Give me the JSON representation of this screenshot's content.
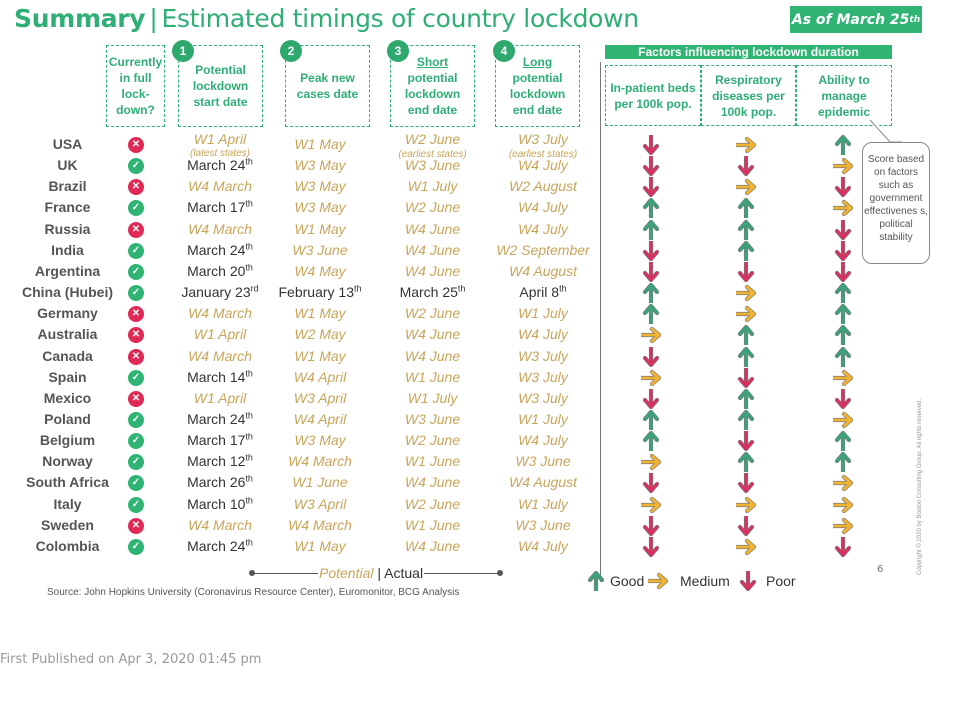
{
  "header": {
    "title_bold": "Summary",
    "title_sep": "|",
    "title_rest": "Estimated timings of country lockdown",
    "as_of_prefix": "As of March 25",
    "as_of_suffix": "th"
  },
  "columns": {
    "currently": "Currently in full lock-down?",
    "c1_num": "1",
    "c1_label": "Potential lockdown start date",
    "c2_num": "2",
    "c2_label": "Peak new cases date",
    "c3_num": "3",
    "c3_label_u": "Short",
    "c3_label": "potential lockdown end date",
    "c4_num": "4",
    "c4_label_u": "Long",
    "c4_label": "potential lockdown end date"
  },
  "factors": {
    "title": "Factors influencing lockdown duration",
    "f1": "In-patient beds per 100k pop.",
    "f2": "Respiratory diseases per 100k pop.",
    "f3": "Ability to manage epidemic",
    "callout": "Score based on factors such as government effectivenes s, political stability"
  },
  "notes": {
    "usa_start": "(latest states)",
    "usa_short": "(earliest states)",
    "usa_long": "(earliest states)"
  },
  "rows": [
    {
      "country": "USA",
      "locked": false,
      "start": "W1 April",
      "start_sup": "",
      "start_actual": false,
      "peak": "W1 May",
      "peak_sup": "",
      "peak_actual": false,
      "short": "W2 June",
      "short_sup": "",
      "short_actual": false,
      "long": "W3 July",
      "long_sup": "",
      "long_actual": false,
      "beds": "down",
      "resp": "right",
      "ability": "up"
    },
    {
      "country": "UK",
      "locked": true,
      "start": "March 24",
      "start_sup": "th",
      "start_actual": true,
      "peak": "W3 May",
      "peak_sup": "",
      "peak_actual": false,
      "short": "W3 June",
      "short_sup": "",
      "short_actual": false,
      "long": "W4 July",
      "long_sup": "",
      "long_actual": false,
      "beds": "down",
      "resp": "down",
      "ability": "right"
    },
    {
      "country": "Brazil",
      "locked": false,
      "start": "W4 March",
      "start_sup": "",
      "start_actual": false,
      "peak": "W3 May",
      "peak_sup": "",
      "peak_actual": false,
      "short": "W1 July",
      "short_sup": "",
      "short_actual": false,
      "long": "W2 August",
      "long_sup": "",
      "long_actual": false,
      "beds": "down",
      "resp": "right",
      "ability": "down"
    },
    {
      "country": "France",
      "locked": true,
      "start": "March 17",
      "start_sup": "th",
      "start_actual": true,
      "peak": "W3 May",
      "peak_sup": "",
      "peak_actual": false,
      "short": "W2 June",
      "short_sup": "",
      "short_actual": false,
      "long": "W4 July",
      "long_sup": "",
      "long_actual": false,
      "beds": "up",
      "resp": "up",
      "ability": "right"
    },
    {
      "country": "Russia",
      "locked": false,
      "start": "W4 March",
      "start_sup": "",
      "start_actual": false,
      "peak": "W1 May",
      "peak_sup": "",
      "peak_actual": false,
      "short": "W4 June",
      "short_sup": "",
      "short_actual": false,
      "long": "W4 July",
      "long_sup": "",
      "long_actual": false,
      "beds": "up",
      "resp": "up",
      "ability": "down"
    },
    {
      "country": "India",
      "locked": true,
      "start": "March 24",
      "start_sup": "th",
      "start_actual": true,
      "peak": "W3 June",
      "peak_sup": "",
      "peak_actual": false,
      "short": "W4 June",
      "short_sup": "",
      "short_actual": false,
      "long": "W2 September",
      "long_sup": "",
      "long_actual": false,
      "beds": "down",
      "resp": "up",
      "ability": "down"
    },
    {
      "country": "Argentina",
      "locked": true,
      "start": "March 20",
      "start_sup": "th",
      "start_actual": true,
      "peak": "W4 May",
      "peak_sup": "",
      "peak_actual": false,
      "short": "W4 June",
      "short_sup": "",
      "short_actual": false,
      "long": "W4 August",
      "long_sup": "",
      "long_actual": false,
      "beds": "down",
      "resp": "down",
      "ability": "down"
    },
    {
      "country": "China (Hubei)",
      "locked": true,
      "start": "January 23",
      "start_sup": "rd",
      "start_actual": true,
      "peak": "February 13",
      "peak_sup": "th",
      "peak_actual": true,
      "short": "March 25",
      "short_sup": "th",
      "short_actual": true,
      "long": "April 8",
      "long_sup": "th",
      "long_actual": true,
      "beds": "up",
      "resp": "right",
      "ability": "up"
    },
    {
      "country": "Germany",
      "locked": false,
      "start": "W4 March",
      "start_sup": "",
      "start_actual": false,
      "peak": "W1 May",
      "peak_sup": "",
      "peak_actual": false,
      "short": "W2 June",
      "short_sup": "",
      "short_actual": false,
      "long": "W1 July",
      "long_sup": "",
      "long_actual": false,
      "beds": "up",
      "resp": "right",
      "ability": "up"
    },
    {
      "country": "Australia",
      "locked": false,
      "start": "W1 April",
      "start_sup": "",
      "start_actual": false,
      "peak": "W2 May",
      "peak_sup": "",
      "peak_actual": false,
      "short": "W4 June",
      "short_sup": "",
      "short_actual": false,
      "long": "W4 July",
      "long_sup": "",
      "long_actual": false,
      "beds": "right",
      "resp": "up",
      "ability": "up"
    },
    {
      "country": "Canada",
      "locked": false,
      "start": "W4 March",
      "start_sup": "",
      "start_actual": false,
      "peak": "W1 May",
      "peak_sup": "",
      "peak_actual": false,
      "short": "W4 June",
      "short_sup": "",
      "short_actual": false,
      "long": "W3 July",
      "long_sup": "",
      "long_actual": false,
      "beds": "down",
      "resp": "up",
      "ability": "up"
    },
    {
      "country": "Spain",
      "locked": true,
      "start": "March 14",
      "start_sup": "th",
      "start_actual": true,
      "peak": "W4 April",
      "peak_sup": "",
      "peak_actual": false,
      "short": "W1 June",
      "short_sup": "",
      "short_actual": false,
      "long": "W3 July",
      "long_sup": "",
      "long_actual": false,
      "beds": "right",
      "resp": "down",
      "ability": "right"
    },
    {
      "country": "Mexico",
      "locked": false,
      "start": "W1 April",
      "start_sup": "",
      "start_actual": false,
      "peak": "W3 April",
      "peak_sup": "",
      "peak_actual": false,
      "short": "W1 July",
      "short_sup": "",
      "short_actual": false,
      "long": "W3 July",
      "long_sup": "",
      "long_actual": false,
      "beds": "down",
      "resp": "up",
      "ability": "down"
    },
    {
      "country": "Poland",
      "locked": true,
      "start": "March 24",
      "start_sup": "th",
      "start_actual": true,
      "peak": "W4 April",
      "peak_sup": "",
      "peak_actual": false,
      "short": "W3 June",
      "short_sup": "",
      "short_actual": false,
      "long": "W1 July",
      "long_sup": "",
      "long_actual": false,
      "beds": "up",
      "resp": "up",
      "ability": "right"
    },
    {
      "country": "Belgium",
      "locked": true,
      "start": "March 17",
      "start_sup": "th",
      "start_actual": true,
      "peak": "W3 May",
      "peak_sup": "",
      "peak_actual": false,
      "short": "W2 June",
      "short_sup": "",
      "short_actual": false,
      "long": "W4 July",
      "long_sup": "",
      "long_actual": false,
      "beds": "up",
      "resp": "down",
      "ability": "up"
    },
    {
      "country": "Norway",
      "locked": true,
      "start": "March 12",
      "start_sup": "th",
      "start_actual": true,
      "peak": "W4 March",
      "peak_sup": "",
      "peak_actual": false,
      "short": "W1 June",
      "short_sup": "",
      "short_actual": false,
      "long": "W3 June",
      "long_sup": "",
      "long_actual": false,
      "beds": "right",
      "resp": "up",
      "ability": "up"
    },
    {
      "country": "South Africa",
      "locked": true,
      "start": "March 26",
      "start_sup": "th",
      "start_actual": true,
      "peak": "W1 June",
      "peak_sup": "",
      "peak_actual": false,
      "short": "W4 June",
      "short_sup": "",
      "short_actual": false,
      "long": "W4 August",
      "long_sup": "",
      "long_actual": false,
      "beds": "down",
      "resp": "down",
      "ability": "right"
    },
    {
      "country": "Italy",
      "locked": true,
      "start": "March 10",
      "start_sup": "th",
      "start_actual": true,
      "peak": "W3 April",
      "peak_sup": "",
      "peak_actual": false,
      "short": "W2 June",
      "short_sup": "",
      "short_actual": false,
      "long": "W1 July",
      "long_sup": "",
      "long_actual": false,
      "beds": "right",
      "resp": "right",
      "ability": "right"
    },
    {
      "country": "Sweden",
      "locked": false,
      "start": "W4 March",
      "start_sup": "",
      "start_actual": false,
      "peak": "W4 March",
      "peak_sup": "",
      "peak_actual": false,
      "short": "W1 June",
      "short_sup": "",
      "short_actual": false,
      "long": "W3 June",
      "long_sup": "",
      "long_actual": false,
      "beds": "down",
      "resp": "down",
      "ability": "right"
    },
    {
      "country": "Colombia",
      "locked": true,
      "start": "March 24",
      "start_sup": "th",
      "start_actual": true,
      "peak": "W1 May",
      "peak_sup": "",
      "peak_actual": false,
      "short": "W4 June",
      "short_sup": "",
      "short_actual": false,
      "long": "W4 July",
      "long_sup": "",
      "long_actual": false,
      "beds": "down",
      "resp": "right",
      "ability": "down"
    }
  ],
  "legend": {
    "potential": "Potential",
    "bar": "|",
    "actual": "Actual",
    "good": "Good",
    "medium": "Medium",
    "poor": "Poor"
  },
  "colors": {
    "brand_green": "#2fb473",
    "good": "#3aa37a",
    "medium": "#f0b432",
    "poor": "#d9305f",
    "potential_text": "#c8a55a"
  },
  "footer": {
    "source": "Source: John Hopkins University (Coronavirus Resource Center), Euromonitor, BCG Analysis",
    "page_number": "6",
    "copyright": "Copyright © 2020 by Boston Consulting Group. All rights reserved.",
    "published": "First Published on Apr 3, 2020 01:45 pm"
  }
}
